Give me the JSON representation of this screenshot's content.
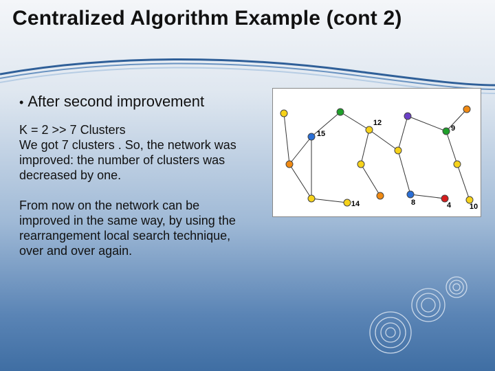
{
  "title": "Centralized Algorithm Example (cont 2)",
  "bullet": {
    "marker": "•",
    "text": "After second improvement"
  },
  "para1": "K = 2 >> 7 Clusters\nWe got 7 clusters . So, the network was improved: the number of clusters was decreased by one.",
  "para2": "From now on the network can be improved in the same way, by using the rearrangement local search technique, over and over again.",
  "diagram": {
    "labels": {
      "n15": "15",
      "n12": "12",
      "n9": "9",
      "n14": "14",
      "n8": "8",
      "n4": "4",
      "n10": "10"
    }
  }
}
